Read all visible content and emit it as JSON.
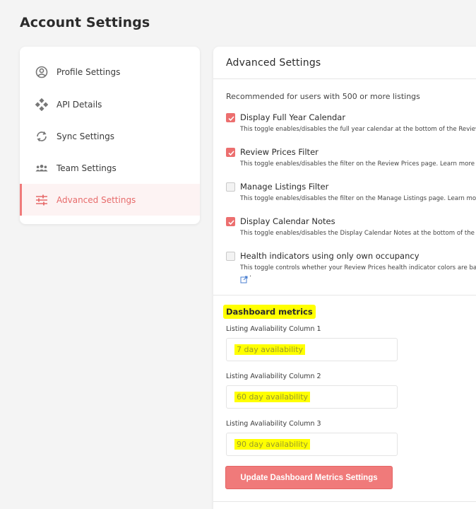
{
  "page": {
    "title": "Account Settings"
  },
  "sidebar": {
    "items": [
      {
        "label": "Profile Settings",
        "icon": "user-circle-icon",
        "active": false
      },
      {
        "label": "API Details",
        "icon": "api-icon",
        "active": false
      },
      {
        "label": "Sync Settings",
        "icon": "sync-icon",
        "active": false
      },
      {
        "label": "Team Settings",
        "icon": "team-icon",
        "active": false
      },
      {
        "label": "Advanced Settings",
        "icon": "sliders-icon",
        "active": true
      }
    ]
  },
  "advanced": {
    "title": "Advanced Settings",
    "intro": "Recommended for users with 500 or more listings",
    "options": [
      {
        "label": "Display Full Year Calendar",
        "checked": true,
        "description": "This toggle enables/disables the full year calendar at the bottom of the Review Prices page."
      },
      {
        "label": "Review Prices Filter",
        "checked": true,
        "description": "This toggle enables/disables the filter on the Review Prices page. Learn more"
      },
      {
        "label": "Manage Listings Filter",
        "checked": false,
        "description": "This toggle enables/disables the filter on the Manage Listings page. Learn more"
      },
      {
        "label": "Display Calendar Notes",
        "checked": true,
        "description": "This toggle enables/disables the Display Calendar Notes at the bottom of the Review Prices page."
      },
      {
        "label": "Health indicators using only own occupancy",
        "checked": false,
        "description": "This toggle controls whether your Review Prices health indicator colors are based on only your own occupancy.",
        "trailing": "."
      }
    ]
  },
  "dashboard": {
    "title": "Dashboard metrics",
    "fields": [
      {
        "label": "Listing Avaliability Column 1",
        "value": "7 day availability"
      },
      {
        "label": "Listing Avaliability Column 2",
        "value": "60 day availability"
      },
      {
        "label": "Listing Avaliability Column 3",
        "value": "90 day availability"
      }
    ],
    "button_label": "Update Dashboard Metrics Settings"
  },
  "colors": {
    "accent": "#f07a7a",
    "highlight": "#ffff00",
    "background": "#f4f4f4"
  }
}
